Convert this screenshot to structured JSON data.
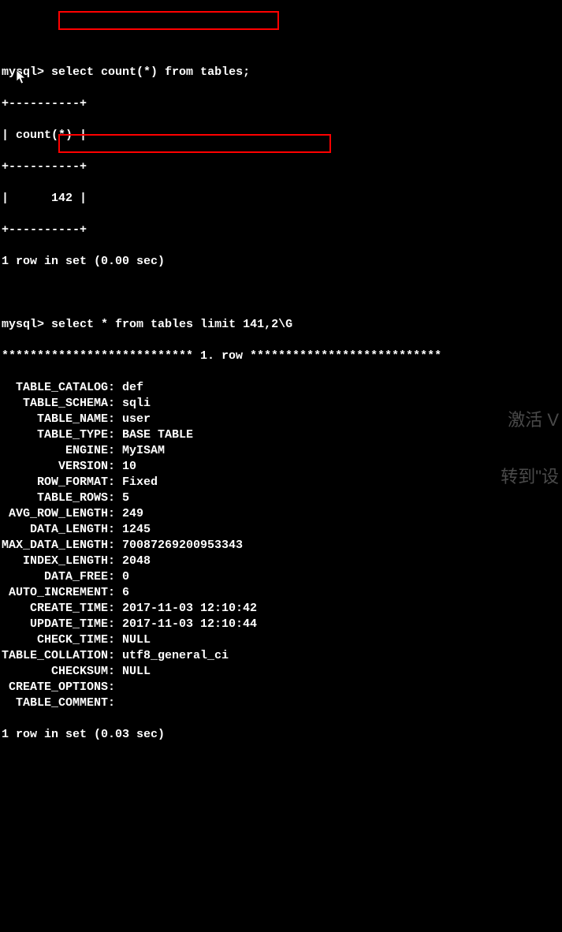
{
  "prompt": "mysql>",
  "query1": {
    "sql": "select count(*) from tables;",
    "border": "+----------+",
    "header": "| count(*) |",
    "value_row": "|      142 |",
    "count_value": 142,
    "footer": "1 row in set (0.00 sec)",
    "elapsed": "0.00 sec"
  },
  "query2": {
    "sql": "select * from tables limit 141,2\\G",
    "row_header": "*************************** 1. row ***************************",
    "fields": [
      {
        "label": "  TABLE_CATALOG",
        "value": "def"
      },
      {
        "label": "   TABLE_SCHEMA",
        "value": "sqli"
      },
      {
        "label": "     TABLE_NAME",
        "value": "user"
      },
      {
        "label": "     TABLE_TYPE",
        "value": "BASE TABLE"
      },
      {
        "label": "         ENGINE",
        "value": "MyISAM"
      },
      {
        "label": "        VERSION",
        "value": "10"
      },
      {
        "label": "     ROW_FORMAT",
        "value": "Fixed"
      },
      {
        "label": "     TABLE_ROWS",
        "value": "5"
      },
      {
        "label": " AVG_ROW_LENGTH",
        "value": "249"
      },
      {
        "label": "    DATA_LENGTH",
        "value": "1245"
      },
      {
        "label": "MAX_DATA_LENGTH",
        "value": "70087269200953343"
      },
      {
        "label": "   INDEX_LENGTH",
        "value": "2048"
      },
      {
        "label": "      DATA_FREE",
        "value": "0"
      },
      {
        "label": " AUTO_INCREMENT",
        "value": "6"
      },
      {
        "label": "    CREATE_TIME",
        "value": "2017-11-03 12:10:42"
      },
      {
        "label": "    UPDATE_TIME",
        "value": "2017-11-03 12:10:44"
      },
      {
        "label": "     CHECK_TIME",
        "value": "NULL"
      },
      {
        "label": "TABLE_COLLATION",
        "value": "utf8_general_ci"
      },
      {
        "label": "       CHECKSUM",
        "value": "NULL"
      },
      {
        "label": " CREATE_OPTIONS",
        "value": ""
      },
      {
        "label": "  TABLE_COMMENT",
        "value": ""
      }
    ],
    "footer": "1 row in set (0.03 sec)",
    "elapsed": "0.03 sec"
  },
  "watermark": {
    "line1": "激活 V",
    "line2": "转到\"设"
  }
}
